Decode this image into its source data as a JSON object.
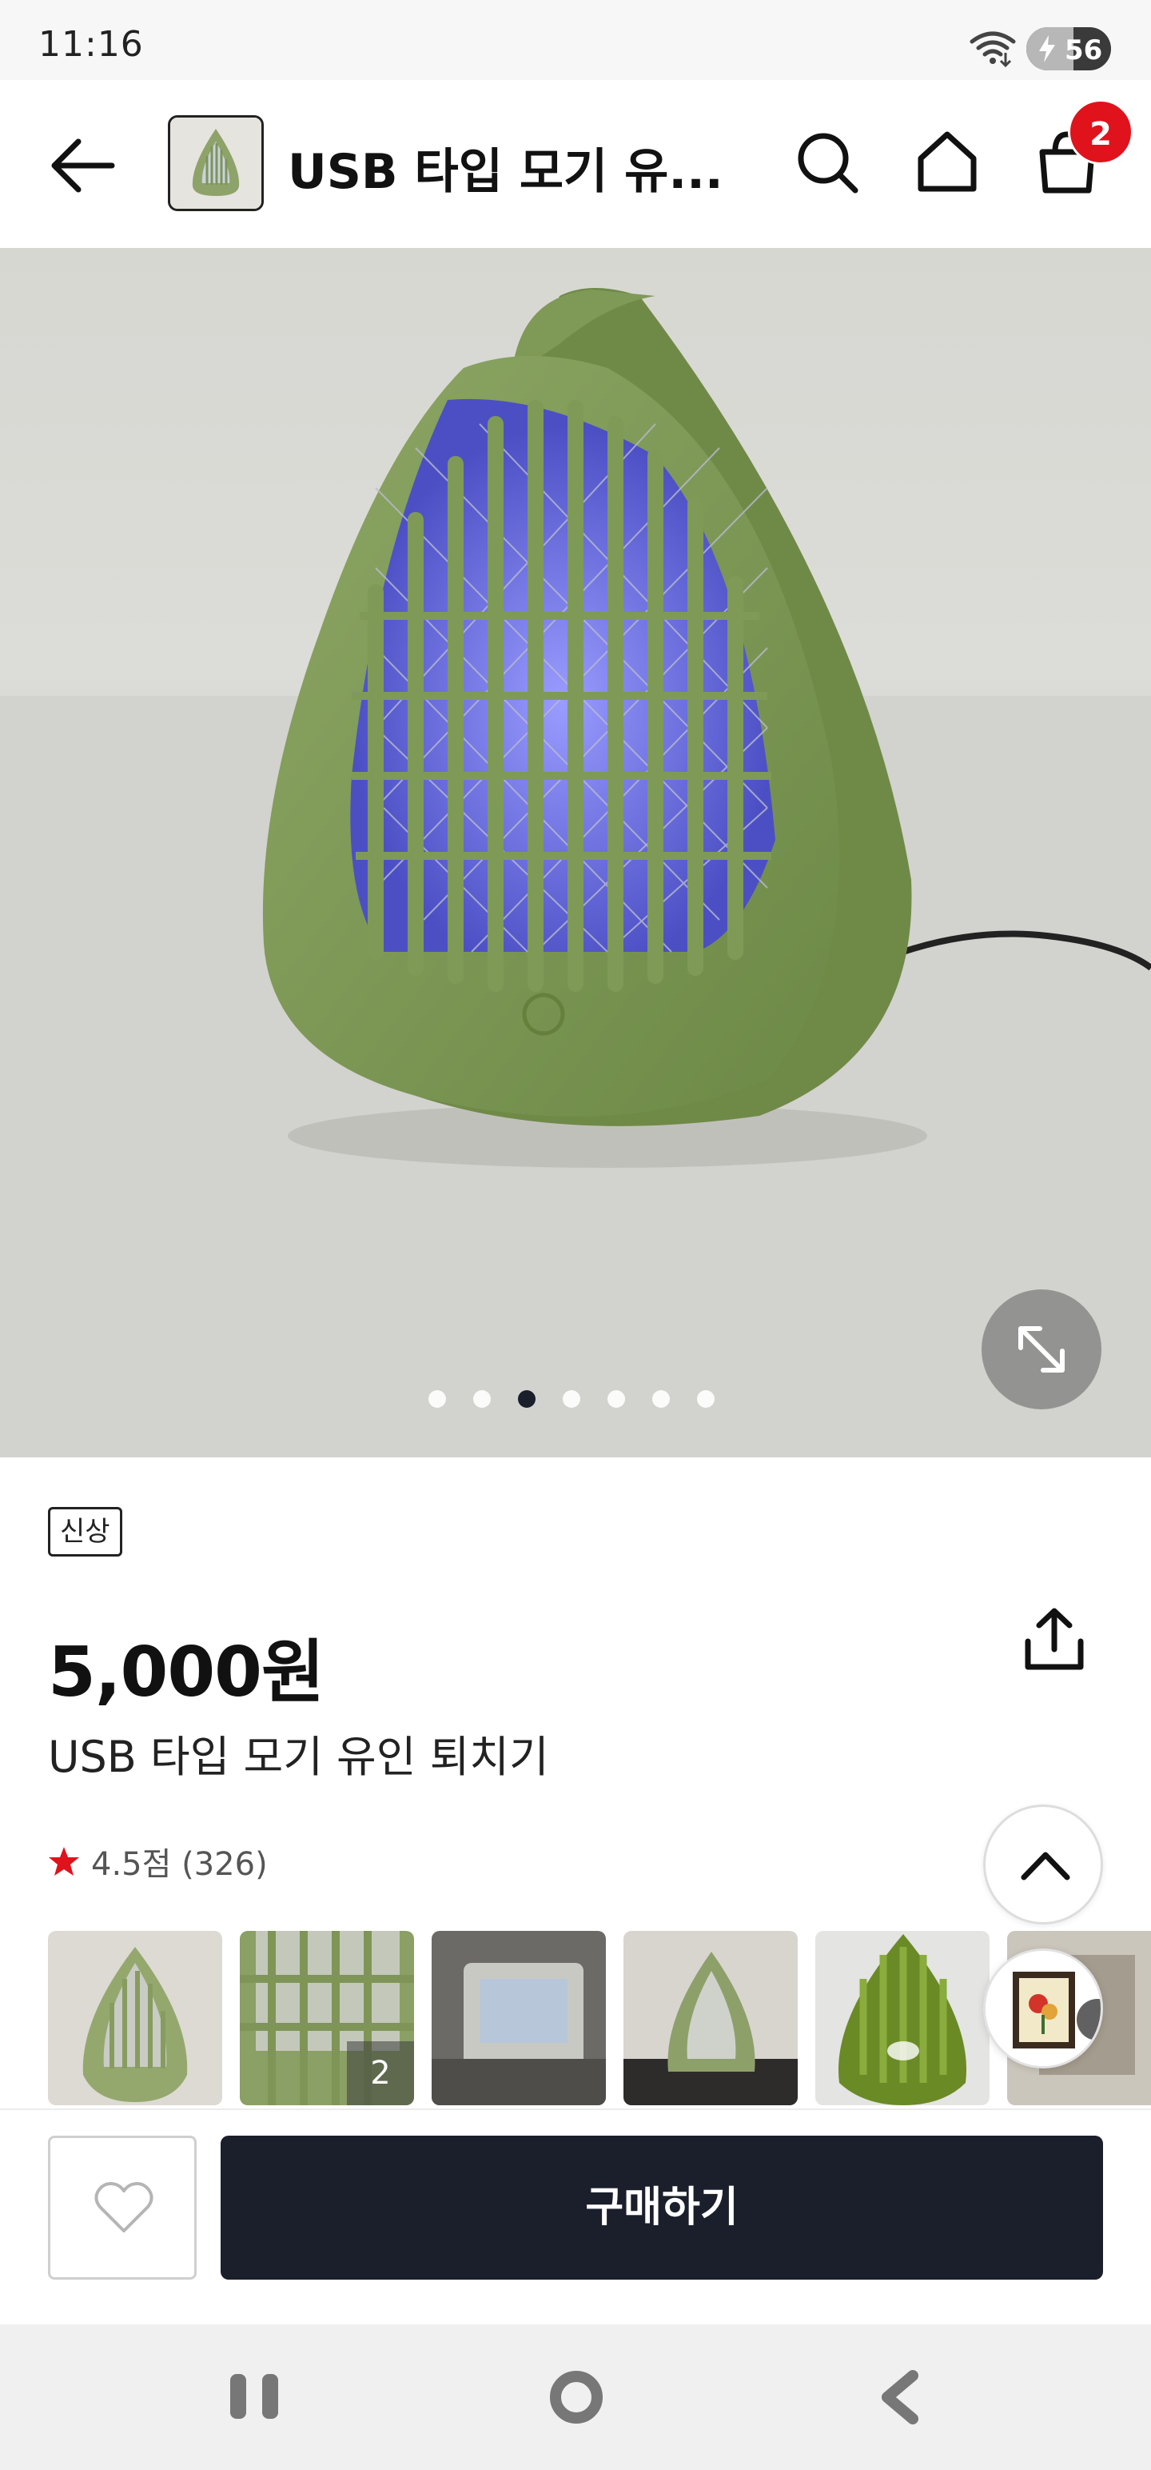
{
  "status_bar": {
    "time": "11:16",
    "battery_level": "56",
    "icons": [
      "wifi-icon",
      "charging-bolt-icon"
    ]
  },
  "header": {
    "title": "USB 타입 모기 유...",
    "cart_count": "2",
    "icons": [
      "back-arrow-icon",
      "search-icon",
      "home-icon",
      "shopping-bag-icon"
    ]
  },
  "gallery": {
    "total_images": 7,
    "active_index": 2,
    "colors": {
      "product": "#7f9a57",
      "light": "#6a6cff"
    }
  },
  "product": {
    "badge": "신상",
    "price": "5,000원",
    "name": "USB 타입 모기 유인 퇴치기",
    "rating_text": "4.5점 (326)",
    "rating_star_color": "#e0121c"
  },
  "review_thumbs": {
    "count_label": "2"
  },
  "purchase": {
    "buy_label": "구매하기",
    "button_color": "#1b1f2b"
  }
}
